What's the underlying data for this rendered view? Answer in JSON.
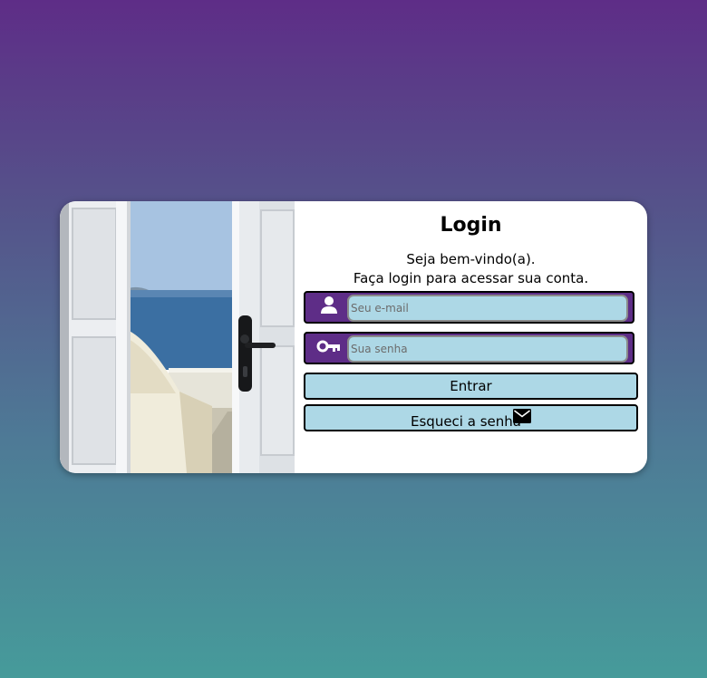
{
  "login": {
    "title": "Login",
    "welcome_line1": "Seja bem-vindo(a).",
    "welcome_line2": "Faça login para acessar sua conta.",
    "email_placeholder": "Seu e-mail",
    "password_placeholder": "Sua senha",
    "submit_label": "Entrar",
    "forgot_label": "Esqueci a senha"
  },
  "icons": {
    "email_field": "user-icon",
    "password_field": "key-icon",
    "forgot_button": "envelope-icon"
  },
  "colors": {
    "gradient_top": "#5e2d87",
    "gradient_bottom": "#469b9a",
    "accent_purple": "#5e2d87",
    "input_fill": "#add8e6",
    "card": "#ffffff"
  }
}
